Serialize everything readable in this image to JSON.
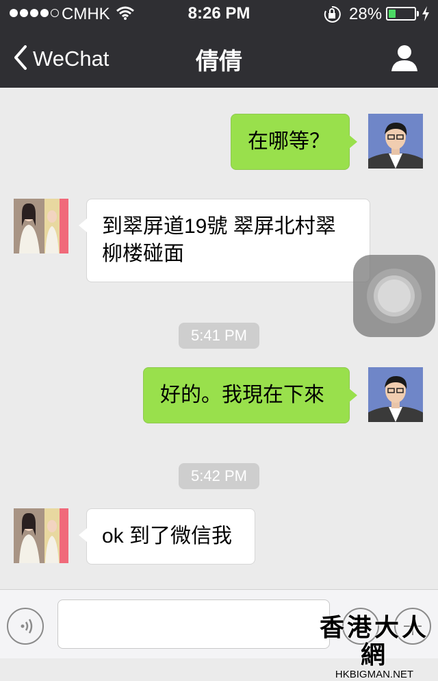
{
  "status_bar": {
    "carrier": "CMHK",
    "time": "8:26 PM",
    "battery_percent": "28%",
    "battery_level": 0.28
  },
  "nav": {
    "back_label": "WeChat",
    "title": "倩倩"
  },
  "messages": [
    {
      "sender": "me",
      "text": "在哪等？"
    },
    {
      "sender": "other",
      "line1": "到翠屏道19號 翠屏北村翠",
      "line2": "柳楼碰面"
    },
    {
      "sender": "me",
      "text": "好的。我現在下來"
    },
    {
      "sender": "other",
      "text": "ok 到了微信我"
    }
  ],
  "timestamps": [
    "5:41 PM",
    "5:42 PM"
  ],
  "input": {
    "value": ""
  },
  "watermark": {
    "title": "香港大人網",
    "site": "HKBIGMAN.NET"
  },
  "colors": {
    "nav_bg": "#2f2f33",
    "my_bubble": "#99e04c",
    "chat_bg": "#ebebeb",
    "battery": "#4cd964"
  },
  "icons": [
    "back-chevron-icon",
    "profile-icon",
    "wifi-icon",
    "rotation-lock-icon",
    "charging-bolt-icon",
    "voice-icon",
    "emoji-icon",
    "plus-icon"
  ]
}
